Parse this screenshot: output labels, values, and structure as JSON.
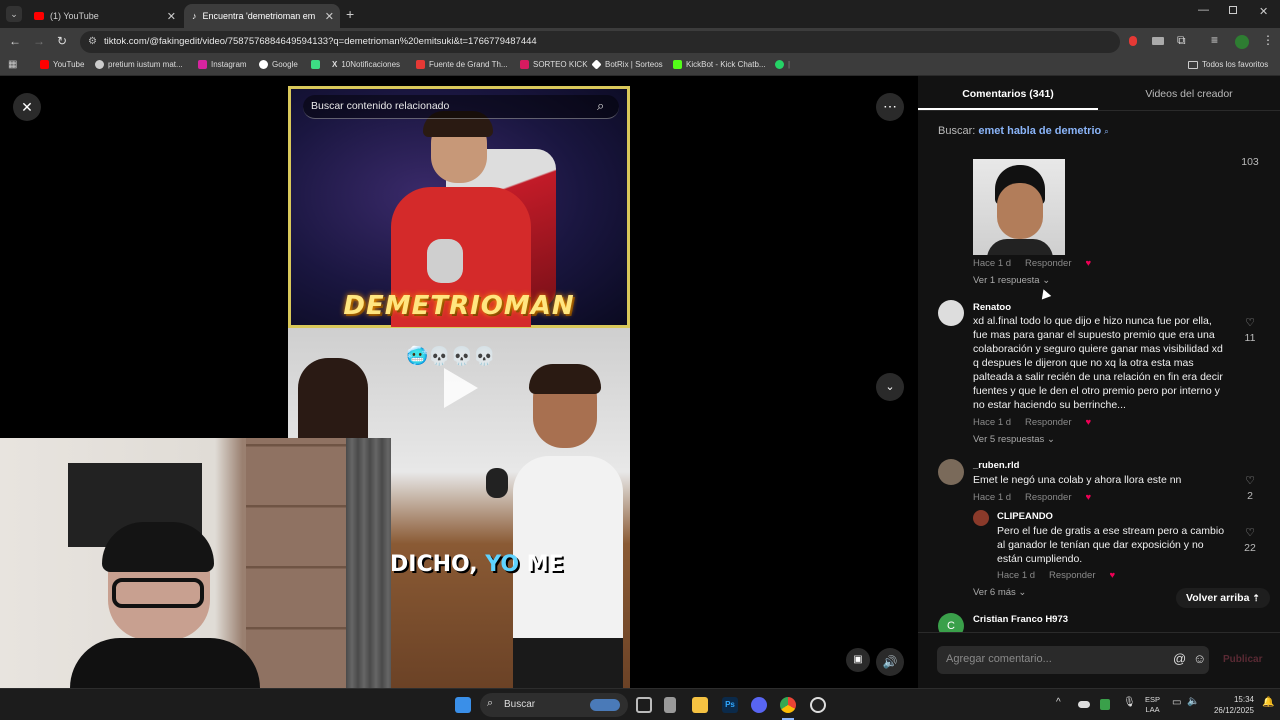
{
  "browser": {
    "tabs": [
      {
        "title": "(1) YouTube"
      },
      {
        "title": "Encuentra 'demetrioman emits"
      }
    ],
    "new_tab": "+",
    "url": "tiktok.com/@fakingedit/video/7587576884649594133?q=demetrioman%20emitsuki&t=1766779487444",
    "bookmarks": [
      {
        "label": "YouTube",
        "color": "#ff0000"
      },
      {
        "label": "pretium iustum mat...",
        "color": "#cccccc"
      },
      {
        "label": "Instagram",
        "color": "#d6249f"
      },
      {
        "label": "Google",
        "color": "#ffffff"
      },
      {
        "label": "",
        "color": "#3ddc84"
      },
      {
        "label": "10Notificaciones",
        "color": "#ffffff"
      },
      {
        "label": "Fuente de Grand Th...",
        "color": "#e53935"
      },
      {
        "label": "SORTEO KICK",
        "color": "#d81b60"
      },
      {
        "label": "BotRix | Sorteos",
        "color": "#ffffff"
      },
      {
        "label": "KickBot - Kick Chatb...",
        "color": "#53fc18"
      },
      {
        "label": "",
        "color": "#25d366"
      }
    ],
    "all_bookmarks": "Todos los favoritos"
  },
  "video": {
    "search_placeholder": "Buscar contenido relacionado",
    "banner_text": "DEMETRIOMAN",
    "emoji_line": "🥶💀💀💀",
    "caption_a": "DICHO, ",
    "caption_b": "YO",
    "caption_c": " ME"
  },
  "panel": {
    "tab_comments": "Comentarios (341)",
    "tab_creator": "Videos del creador",
    "search_prefix": "Buscar:",
    "search_term": "emet habla de demetrio",
    "comments": [
      {
        "user": "",
        "text": "",
        "time": "Hace 1 d",
        "reply": "Responder",
        "likes": "103",
        "more": "Ver 1 respuesta"
      },
      {
        "user": "Renatoo",
        "text": "xd al.final todo lo que dijo e hizo nunca fue por ella, fue mas para ganar el supuesto premio que era una colaboración y seguro quiere ganar mas visibilidad xd q despues le dijeron que no xq la otra esta mas palteada a salir recién de una relación en fin era decir fuentes y que le den el otro premio pero por interno y no estar haciendo su berrinche...",
        "time": "Hace 1 d",
        "reply": "Responder",
        "likes": "11",
        "more": "Ver 5 respuestas"
      },
      {
        "user": "_ruben.rld",
        "text": "Emet le negó una colab y ahora llora este nn",
        "time": "Hace 1 d",
        "reply": "Responder",
        "likes": "2",
        "more": ""
      },
      {
        "user": "CLIPEANDO",
        "text": "Pero el fue de gratis a ese stream pero a cambio al ganador le tenían que dar exposición y no están cumpliendo.",
        "time": "Hace 1 d",
        "reply": "Responder",
        "likes": "22",
        "more": "Ver 6 más"
      },
      {
        "user": "Cristian Franco H973",
        "text": "",
        "time": "",
        "reply": "",
        "likes": "",
        "more": ""
      }
    ],
    "back_top": "Volver arriba",
    "add_comment_placeholder": "Agregar comentario...",
    "publish": "Publicar"
  },
  "taskbar": {
    "search": "Buscar",
    "lang1": "ESP",
    "lang2": "LAA",
    "time": "15:34",
    "date": "26/12/2025"
  }
}
